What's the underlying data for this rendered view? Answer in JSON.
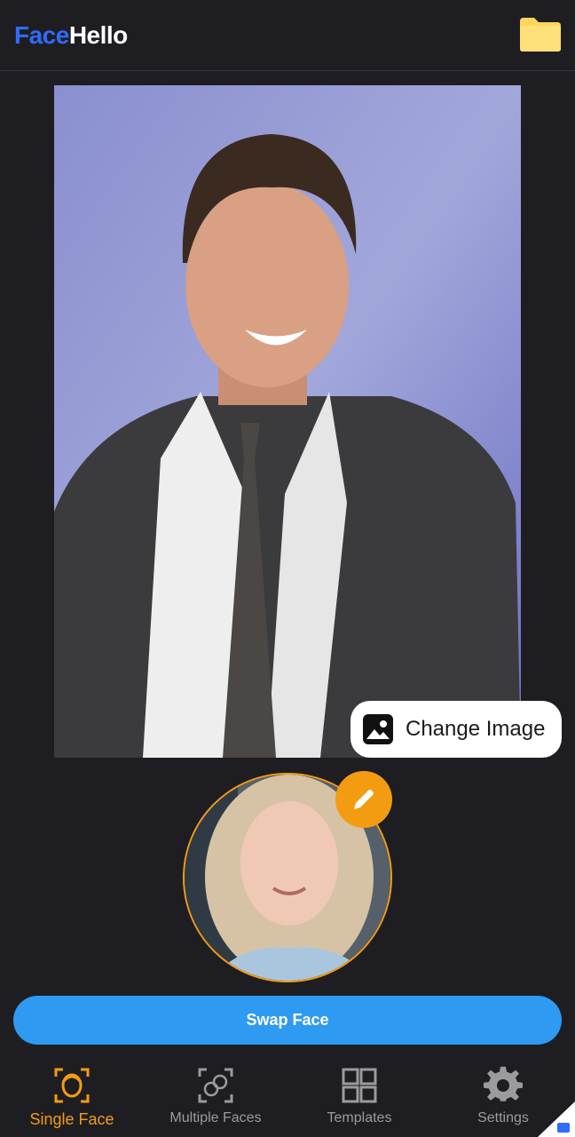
{
  "app": {
    "logo_part1": "Face",
    "logo_part2": "Hello",
    "folder_icon": "folder-icon"
  },
  "colors": {
    "background": "#1e1e22",
    "brand_blue": "#2f6bff",
    "accent_orange": "#f39c12",
    "button_blue": "#2f9af2",
    "folder_yellow": "#ffd55c"
  },
  "main_image": {
    "change_label": "Change Image",
    "change_icon": "image-icon"
  },
  "source_face": {
    "edit_icon": "pencil-icon"
  },
  "action": {
    "swap_label": "Swap Face"
  },
  "nav": {
    "items": [
      {
        "label": "Single Face",
        "icon": "single-face-icon",
        "active": true
      },
      {
        "label": "Multiple Faces",
        "icon": "multiple-faces-icon",
        "active": false
      },
      {
        "label": "Templates",
        "icon": "templates-icon",
        "active": false
      },
      {
        "label": "Settings",
        "icon": "gear-icon",
        "active": false
      }
    ]
  }
}
